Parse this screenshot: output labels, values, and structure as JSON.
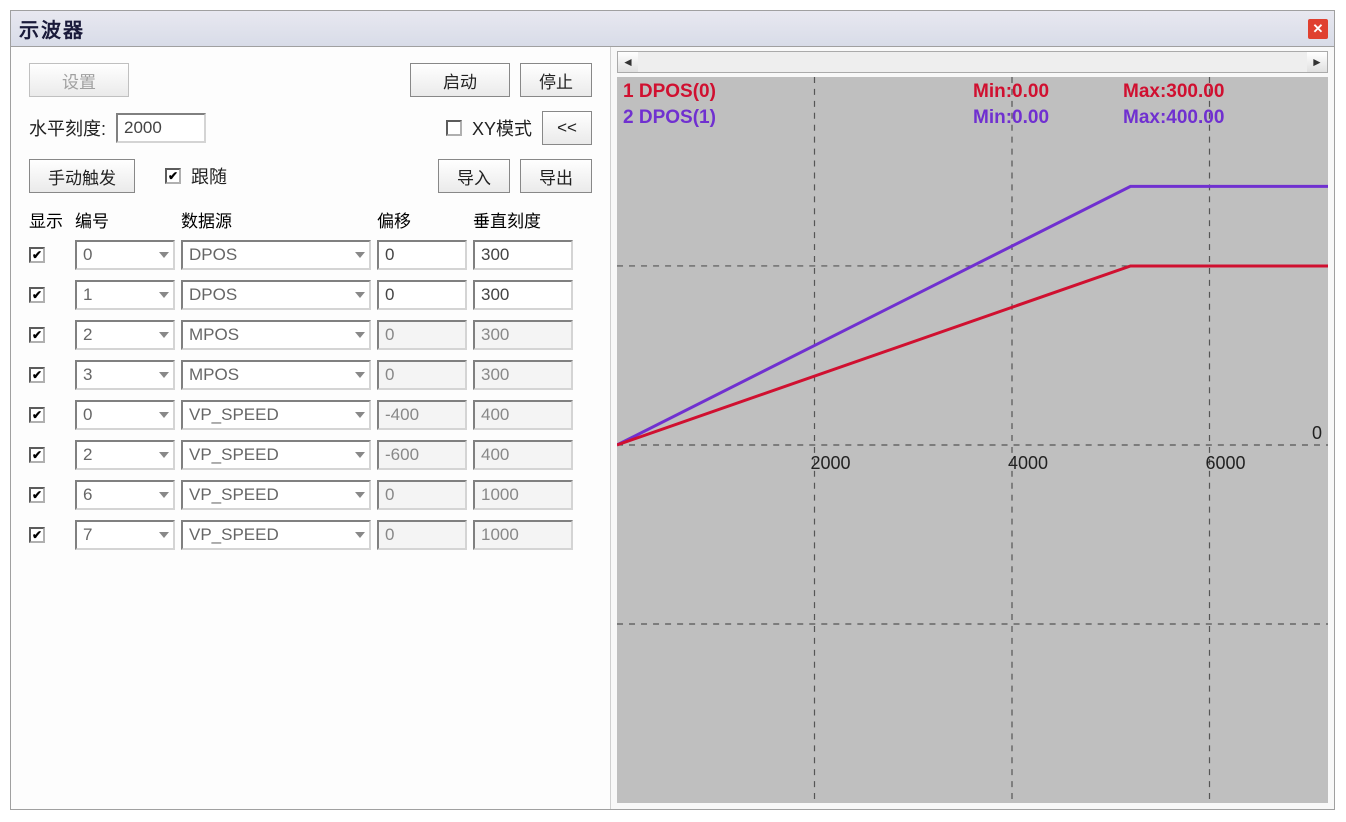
{
  "window": {
    "title": "示波器"
  },
  "toolbar": {
    "settings_label": "设置",
    "start_label": "启动",
    "stop_label": "停止"
  },
  "controls": {
    "hscale_label": "水平刻度:",
    "hscale_value": "2000",
    "xy_mode_label": "XY模式",
    "xy_mode_checked": false,
    "collapse_label": "<<",
    "manual_trigger_label": "手动触发",
    "follow_label": "跟随",
    "follow_checked": true,
    "import_label": "导入",
    "export_label": "导出"
  },
  "columns": {
    "show": "显示",
    "number": "编号",
    "source": "数据源",
    "offset": "偏移",
    "vscale": "垂直刻度"
  },
  "channels": [
    {
      "show": true,
      "number": "0",
      "source": "DPOS",
      "offset": "0",
      "vscale": "300",
      "enabled": true
    },
    {
      "show": true,
      "number": "1",
      "source": "DPOS",
      "offset": "0",
      "vscale": "300",
      "enabled": true
    },
    {
      "show": true,
      "number": "2",
      "source": "MPOS",
      "offset": "0",
      "vscale": "300",
      "enabled": false
    },
    {
      "show": true,
      "number": "3",
      "source": "MPOS",
      "offset": "0",
      "vscale": "300",
      "enabled": false
    },
    {
      "show": true,
      "number": "0",
      "source": "VP_SPEED",
      "offset": "-400",
      "vscale": "400",
      "enabled": false
    },
    {
      "show": true,
      "number": "2",
      "source": "VP_SPEED",
      "offset": "-600",
      "vscale": "400",
      "enabled": false
    },
    {
      "show": true,
      "number": "6",
      "source": "VP_SPEED",
      "offset": "0",
      "vscale": "1000",
      "enabled": false
    },
    {
      "show": true,
      "number": "7",
      "source": "VP_SPEED",
      "offset": "0",
      "vscale": "1000",
      "enabled": false
    }
  ],
  "chart_data": {
    "type": "line",
    "xlabel": "",
    "ylabel": "",
    "x_ticks": [
      2000,
      4000,
      6000
    ],
    "xlim": [
      0,
      7200
    ],
    "zero_label": "0",
    "series": [
      {
        "name": "1 DPOS(0)",
        "min": "Min:0.00",
        "max": "Max:300.00",
        "color": "#d01030",
        "x": [
          0,
          5200,
          7200
        ],
        "y": [
          0,
          300,
          300
        ]
      },
      {
        "name": "2 DPOS(1)",
        "min": "Min:0.00",
        "max": "Max:400.00",
        "color": "#7030d0",
        "x": [
          0,
          5200,
          7200
        ],
        "y": [
          0,
          400,
          400
        ]
      }
    ],
    "y_baseline": 0,
    "y_max_viz": 500
  }
}
